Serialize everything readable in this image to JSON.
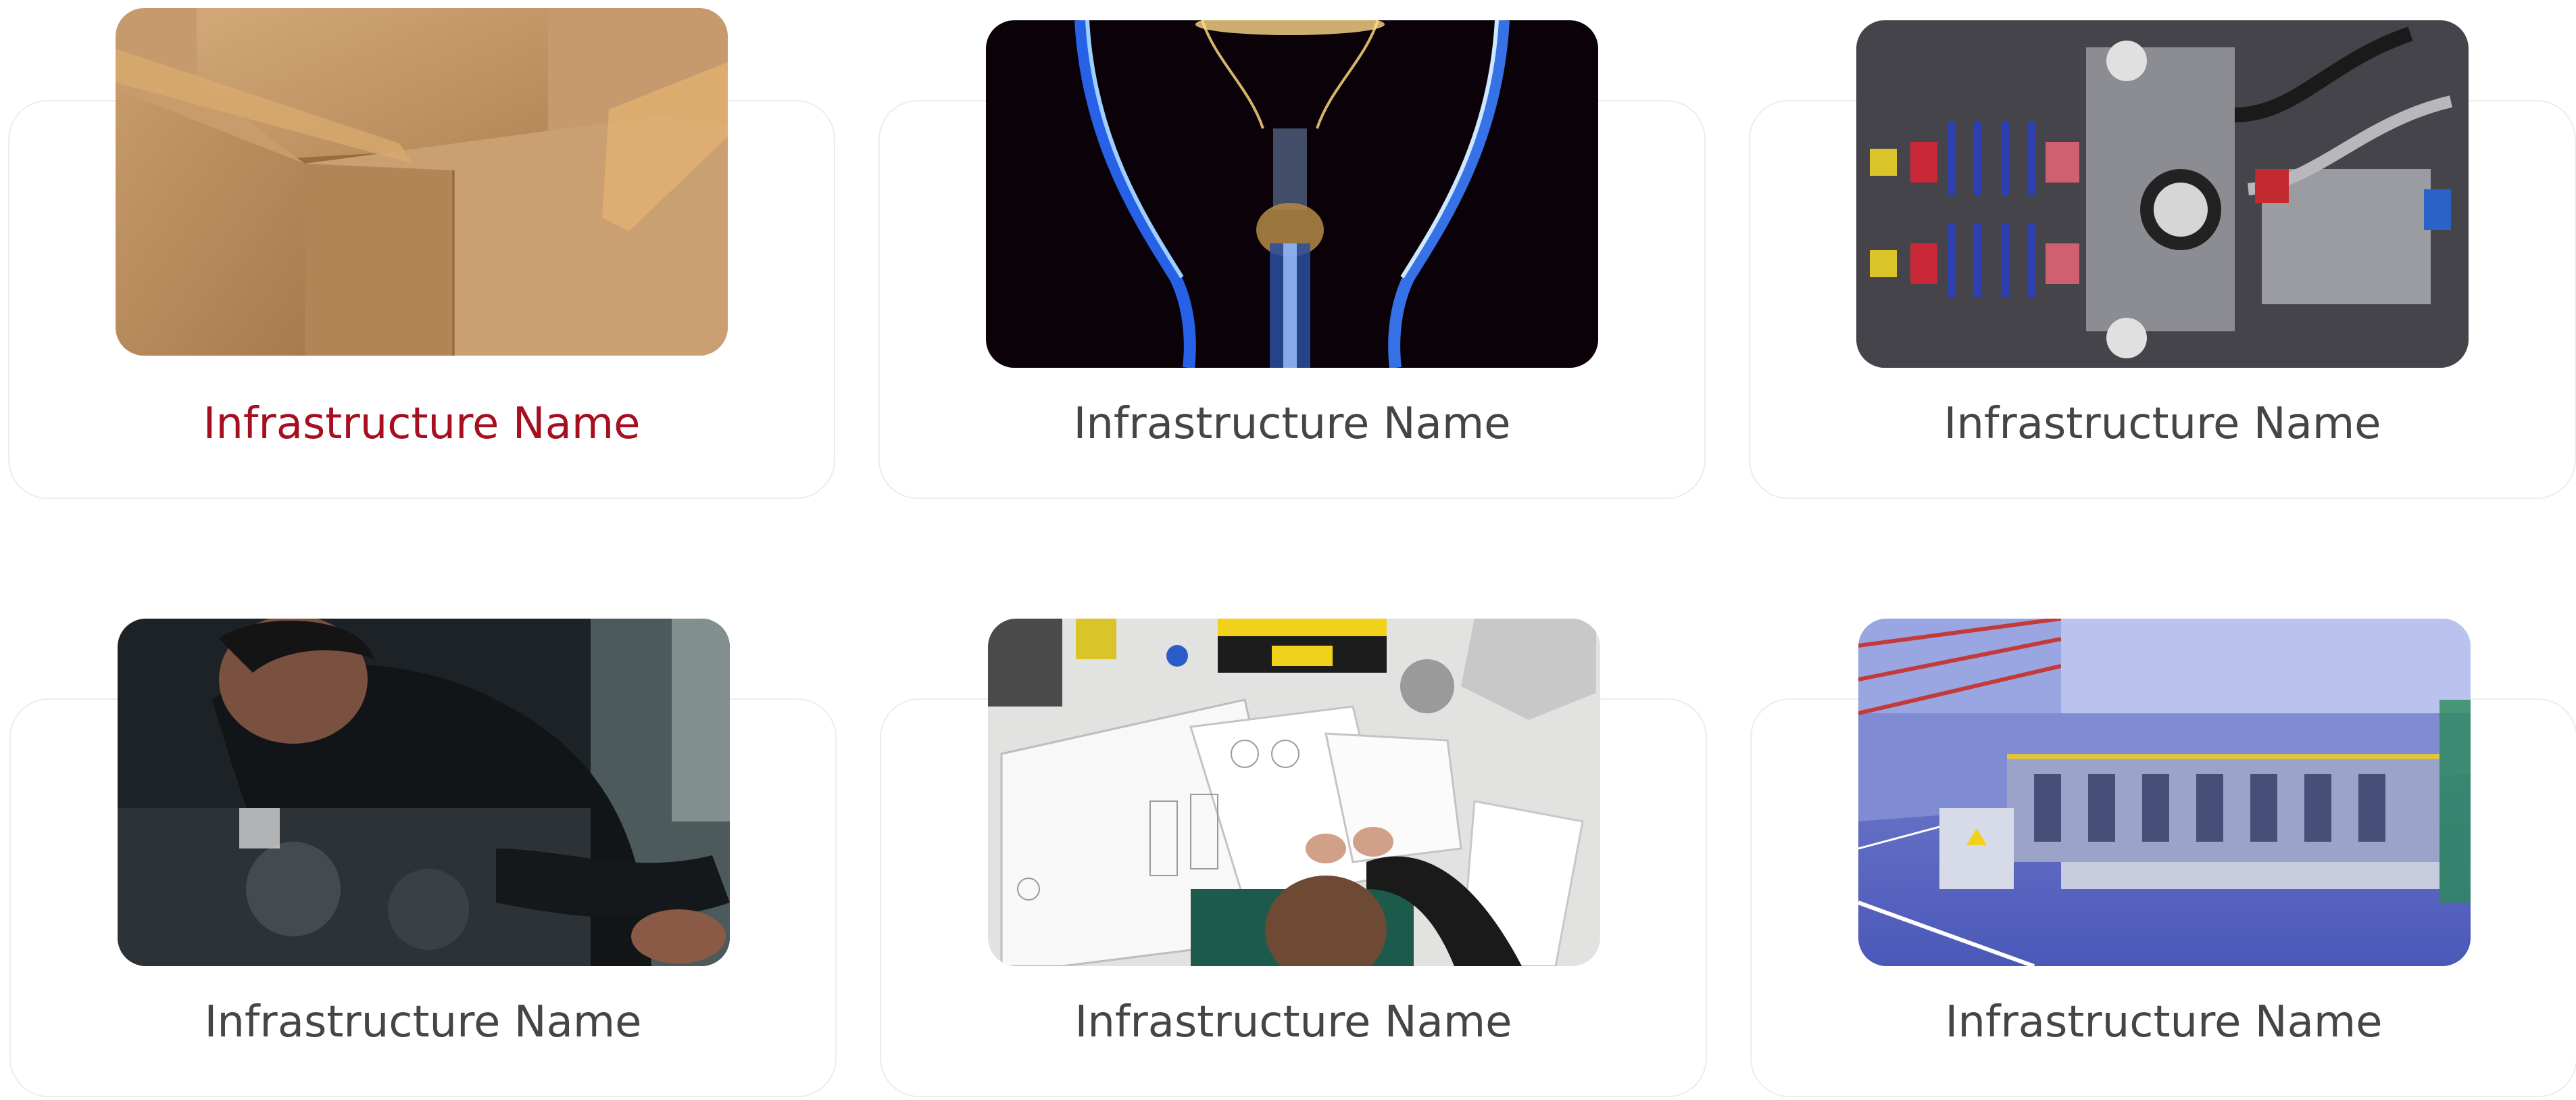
{
  "accent_color": "#a50f20",
  "text_color": "#454545",
  "infrastructure_items": [
    {
      "name": "Infrastructure Name",
      "image_icon": "cardboard-boxes-image",
      "active": true
    },
    {
      "name": "Infrastructure Name",
      "image_icon": "light-bulb-filament-image",
      "active": false
    },
    {
      "name": "Infrastructure Name",
      "image_icon": "machinery-suspension-image",
      "active": false
    },
    {
      "name": "Infrastructure Name",
      "image_icon": "mechanic-at-work-image",
      "active": false
    },
    {
      "name": "Infrastructure Name",
      "image_icon": "technical-drawing-desk-image",
      "active": false
    },
    {
      "name": "Infrastructure Name",
      "image_icon": "factory-production-line-image",
      "active": false
    }
  ]
}
